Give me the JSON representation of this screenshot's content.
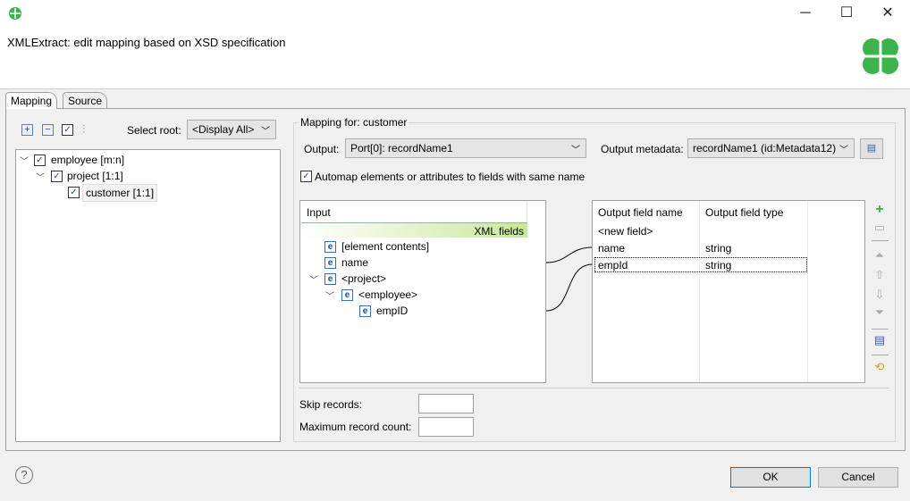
{
  "window": {
    "title": "XMLExtract: edit mapping based on XSD specification",
    "minimize": "─",
    "maximize": "☐",
    "close": "✕"
  },
  "tabs": [
    {
      "label": "Mapping"
    },
    {
      "label": "Source"
    }
  ],
  "left": {
    "select_root_label": "Select root:",
    "select_root_value": "<Display All>",
    "tree": [
      {
        "label": "employee [m:n]",
        "checked": true
      },
      {
        "label": "project [1:1]",
        "checked": true
      },
      {
        "label": "customer [1:1]",
        "checked": true
      }
    ]
  },
  "mapping": {
    "group_label": "Mapping for: customer",
    "output_label": "Output:",
    "output_value": "Port[0]: recordName1",
    "output_metadata_label": "Output metadata:",
    "output_metadata_value": "recordName1 (id:Metadata12)",
    "automap_label": "Automap elements or attributes to fields with same name",
    "automap_checked": true,
    "input_header": "Input",
    "xml_fields_label": "XML fields",
    "input_items": [
      {
        "label": "[element contents]",
        "icon": "e"
      },
      {
        "label": "name",
        "icon": "e"
      },
      {
        "label": "<project>",
        "icon": "e"
      },
      {
        "label": "<employee>",
        "icon": "e"
      },
      {
        "label": "empID",
        "icon": "e"
      }
    ],
    "output_headers": [
      "Output field name",
      "Output field type"
    ],
    "output_rows": [
      {
        "name": "<new field>",
        "type": ""
      },
      {
        "name": "name",
        "type": "string"
      },
      {
        "name": "empId",
        "type": "string"
      }
    ],
    "skip_records_label": "Skip records:",
    "skip_records_value": "",
    "max_record_label": "Maximum record count:",
    "max_record_value": ""
  },
  "footer": {
    "ok": "OK",
    "cancel": "Cancel",
    "help": "?"
  },
  "colors": {
    "accent_green": "#3cb44b",
    "xml_bar": "#c8e89a"
  }
}
